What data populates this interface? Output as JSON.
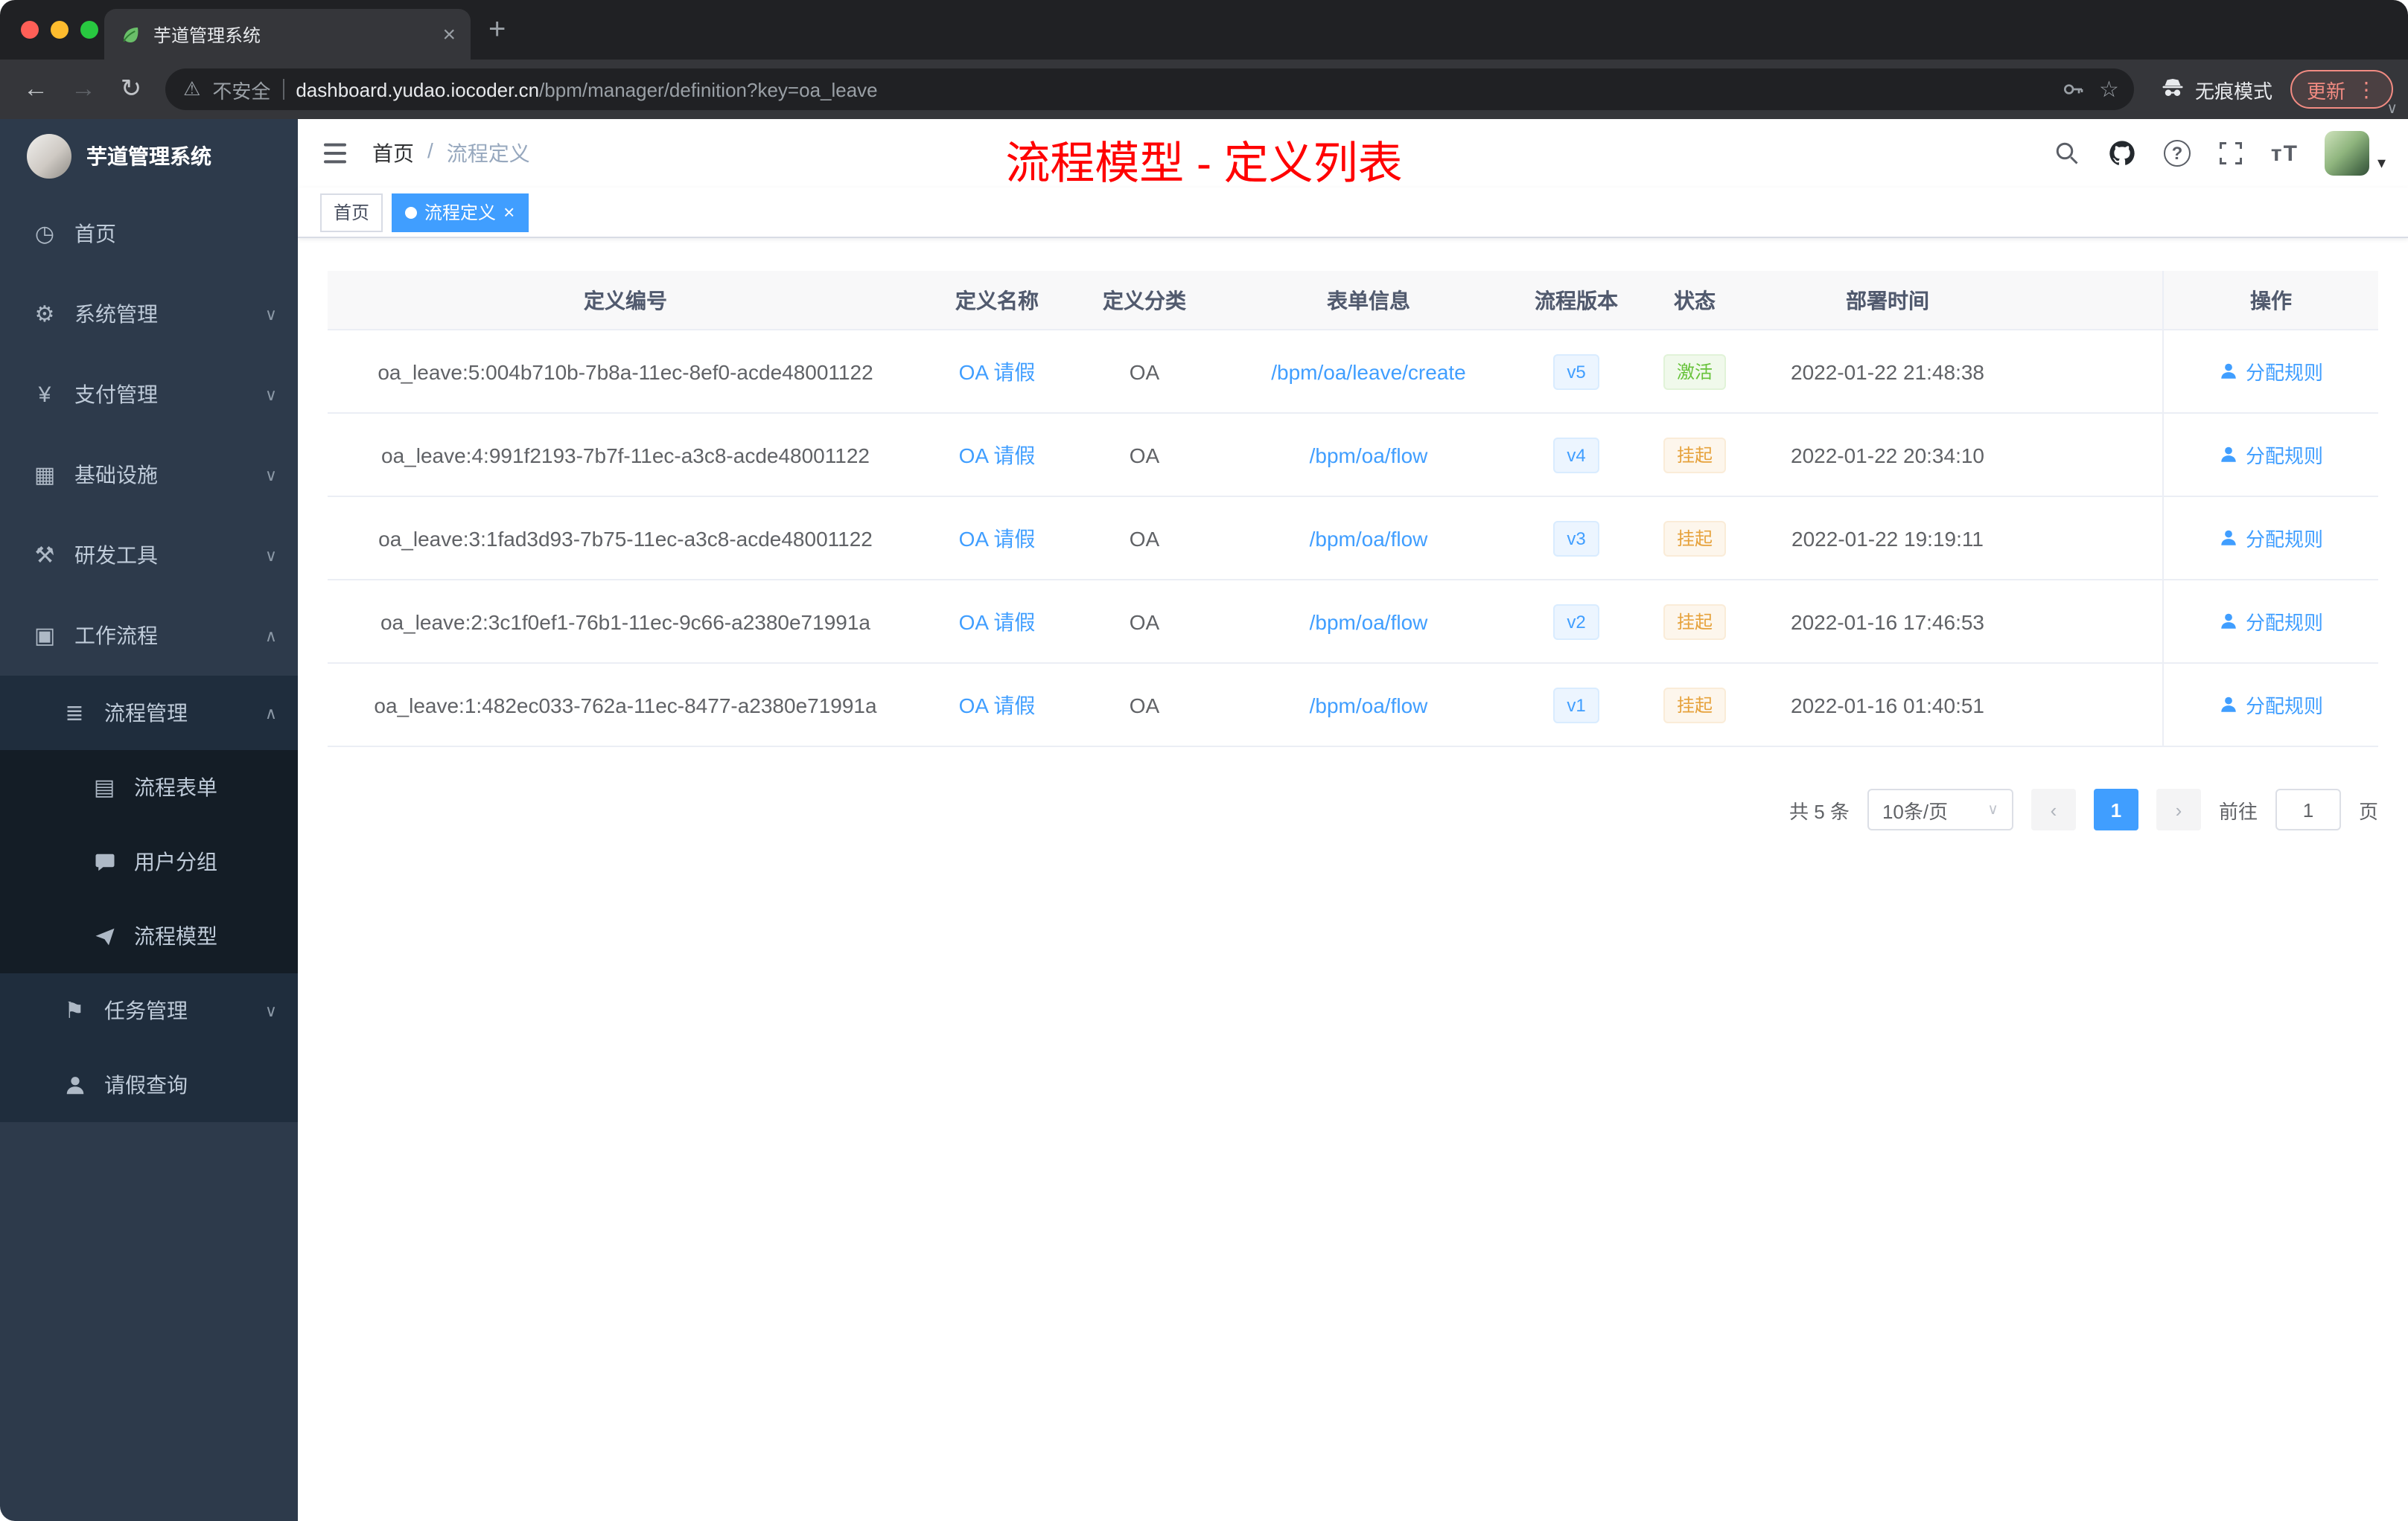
{
  "browser": {
    "tab_title": "芋道管理系统",
    "security_label": "不安全",
    "url_host": "dashboard.yudao.iocoder.cn",
    "url_path": "/bpm/manager/definition?key=oa_leave",
    "incognito_label": "无痕模式",
    "update_label": "更新"
  },
  "icons": {
    "close": "×",
    "plus": "+",
    "back": "←",
    "forward": "→",
    "reload": "↻",
    "warning": "⚠",
    "star": "☆",
    "dots": "⋮",
    "chevron_down": "∨",
    "chevron_up": "∧",
    "caret": "▾",
    "question": "?",
    "font_size": "тT",
    "prev": "‹",
    "next": "›",
    "dashboard": "◷",
    "gear": "⚙",
    "yen": "¥",
    "infra": "▦",
    "tools": "⚒",
    "workflow": "▣",
    "list": "≣",
    "form": "▤",
    "task": "⚑"
  },
  "sidebar": {
    "logo_title": "芋道管理系统",
    "items": [
      {
        "label": "首页"
      },
      {
        "label": "系统管理"
      },
      {
        "label": "支付管理"
      },
      {
        "label": "基础设施"
      },
      {
        "label": "研发工具"
      },
      {
        "label": "工作流程"
      },
      {
        "label": "流程管理"
      },
      {
        "label": "流程表单"
      },
      {
        "label": "用户分组"
      },
      {
        "label": "流程模型"
      },
      {
        "label": "任务管理"
      },
      {
        "label": "请假查询"
      }
    ]
  },
  "header": {
    "breadcrumb": {
      "home": "首页",
      "separator": "/",
      "current": "流程定义"
    },
    "page_title": "流程模型 - 定义列表"
  },
  "tags": {
    "home": "首页",
    "active": "流程定义"
  },
  "table": {
    "columns": [
      "定义编号",
      "定义名称",
      "定义分类",
      "表单信息",
      "流程版本",
      "状态",
      "部署时间",
      "操作"
    ],
    "action_label": "分配规则",
    "rows": [
      {
        "id": "oa_leave:5:004b710b-7b8a-11ec-8ef0-acde48001122",
        "name": "OA 请假",
        "category": "OA",
        "form": "/bpm/oa/leave/create",
        "version": "v5",
        "status": "激活",
        "time": "2022-01-22 21:48:38"
      },
      {
        "id": "oa_leave:4:991f2193-7b7f-11ec-a3c8-acde48001122",
        "name": "OA 请假",
        "category": "OA",
        "form": "/bpm/oa/flow",
        "version": "v4",
        "status": "挂起",
        "time": "2022-01-22 20:34:10"
      },
      {
        "id": "oa_leave:3:1fad3d93-7b75-11ec-a3c8-acde48001122",
        "name": "OA 请假",
        "category": "OA",
        "form": "/bpm/oa/flow",
        "version": "v3",
        "status": "挂起",
        "time": "2022-01-22 19:19:11"
      },
      {
        "id": "oa_leave:2:3c1f0ef1-76b1-11ec-9c66-a2380e71991a",
        "name": "OA 请假",
        "category": "OA",
        "form": "/bpm/oa/flow",
        "version": "v2",
        "status": "挂起",
        "time": "2022-01-16 17:46:53"
      },
      {
        "id": "oa_leave:1:482ec033-762a-11ec-8477-a2380e71991a",
        "name": "OA 请假",
        "category": "OA",
        "form": "/bpm/oa/flow",
        "version": "v1",
        "status": "挂起",
        "time": "2022-01-16 01:40:51"
      }
    ]
  },
  "pagination": {
    "total": "共 5 条",
    "page_size": "10条/页",
    "page": "1",
    "goto_label": "前往",
    "goto_value": "1",
    "goto_unit": "页"
  },
  "colors": {
    "accent": "#409eff",
    "success": "#67c23a",
    "warning": "#e6a23c",
    "title_red": "#ff0000"
  }
}
